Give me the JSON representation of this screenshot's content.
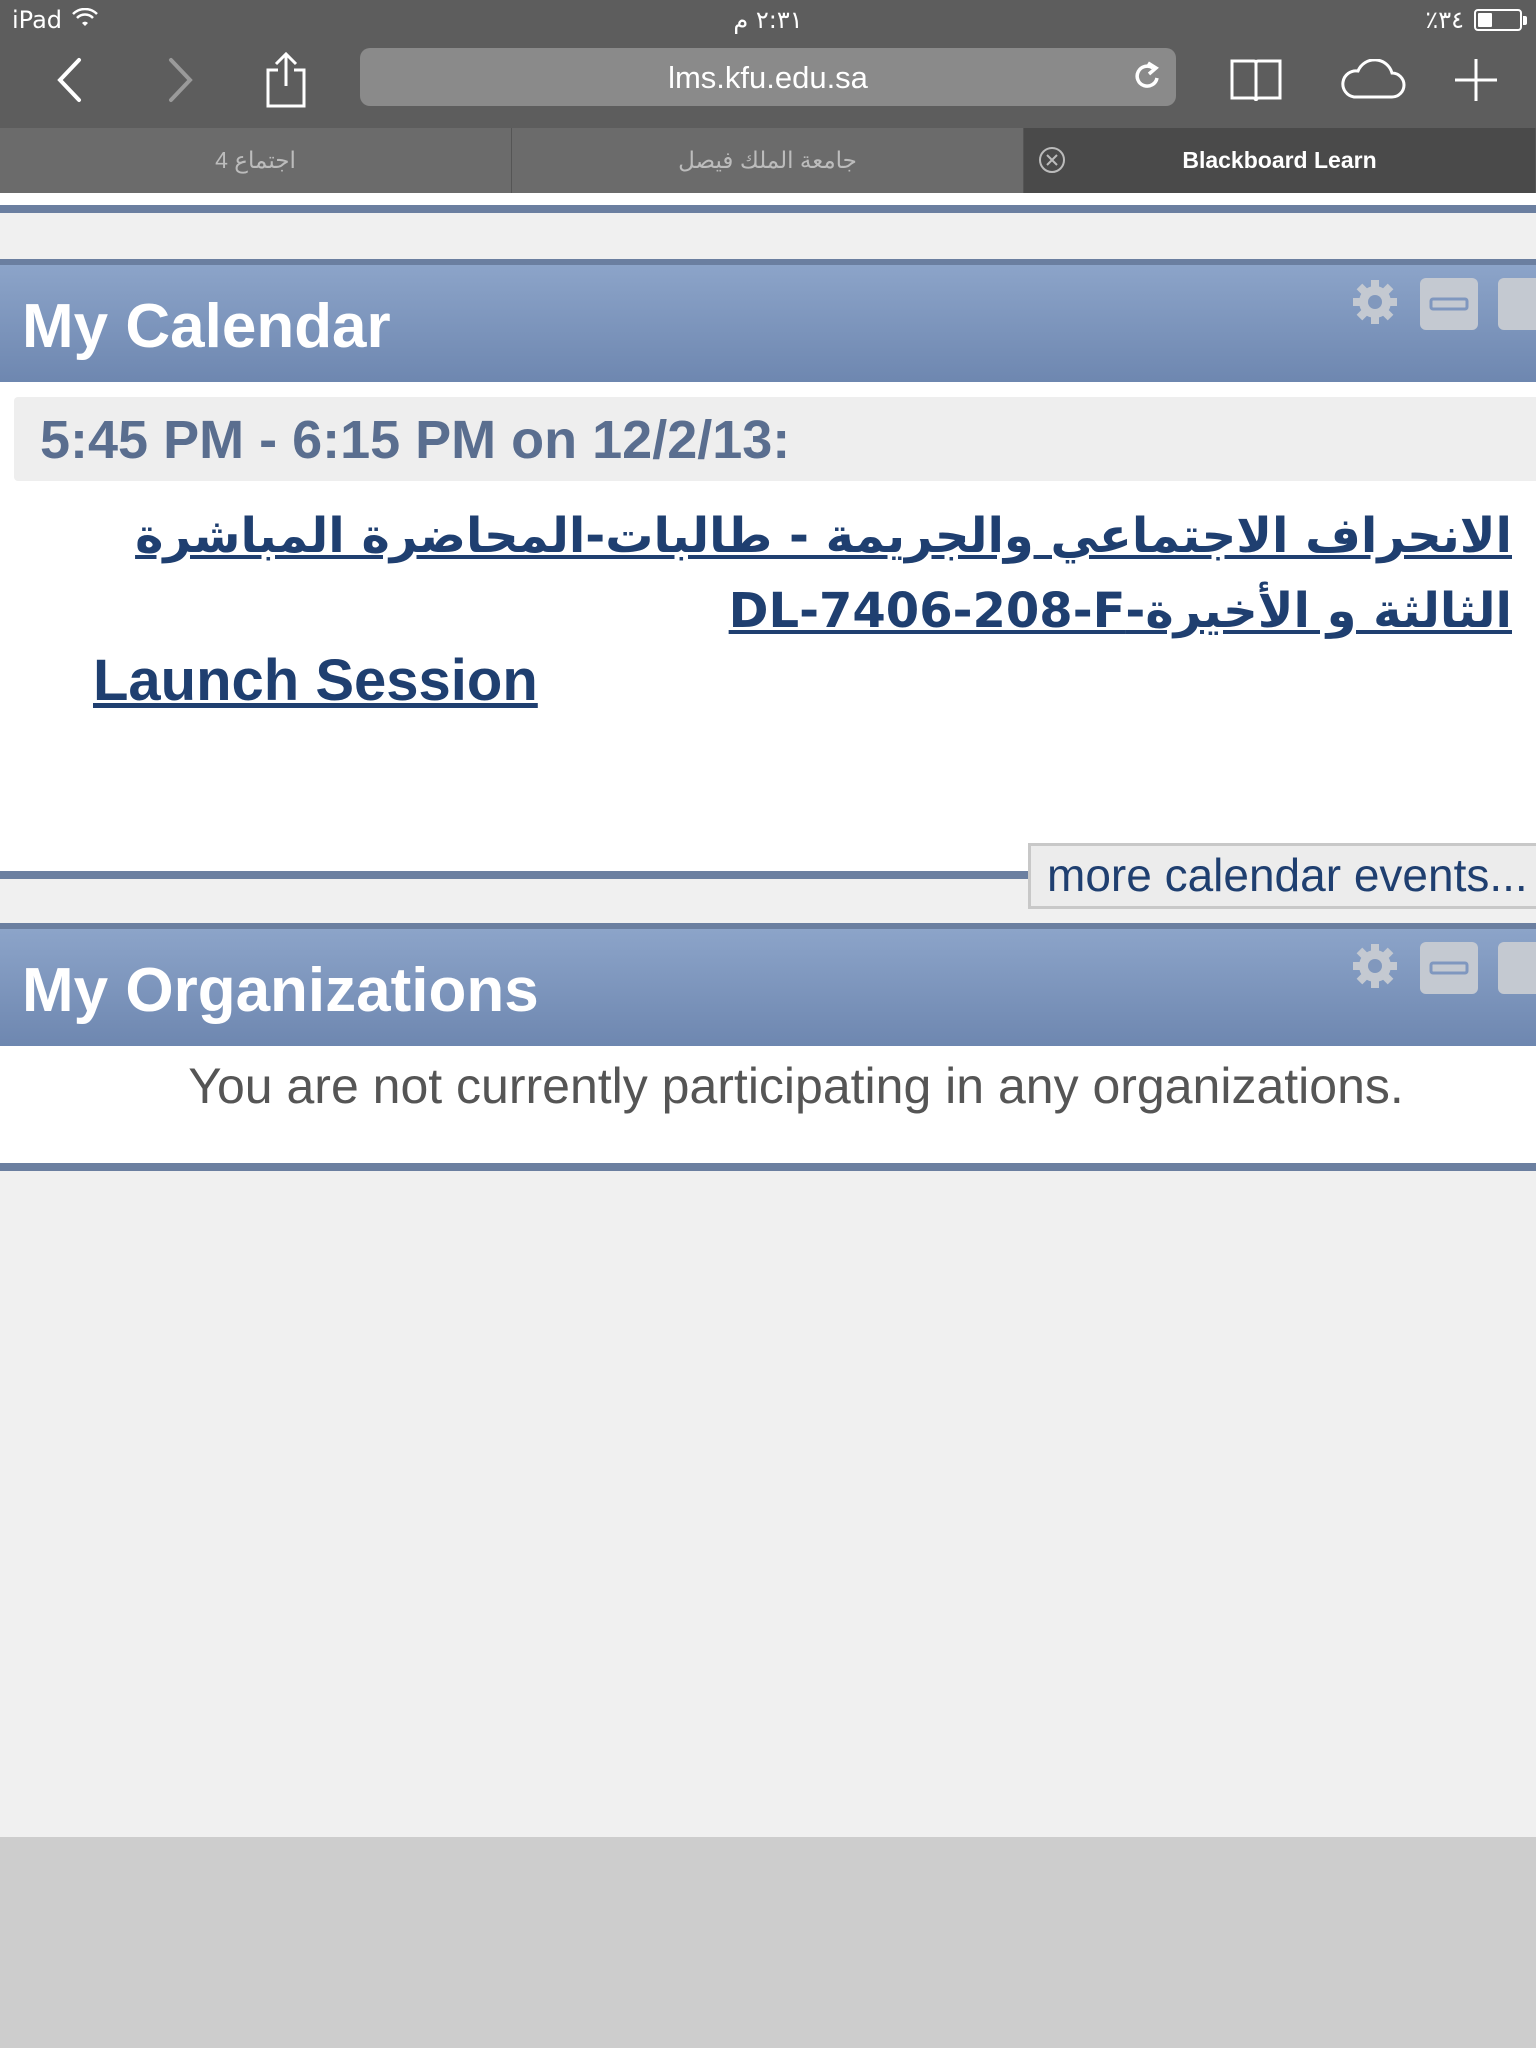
{
  "status": {
    "device": "iPad",
    "time": "٢:٣١ م",
    "battery": "٪٣٤",
    "battery_level": 0.34
  },
  "browser": {
    "url": "lms.kfu.edu.sa",
    "tabs": [
      {
        "label": "اجتماع 4"
      },
      {
        "label": "جامعة الملك فيصل"
      },
      {
        "label": "Blackboard Learn",
        "active": true
      }
    ]
  },
  "calendar": {
    "title": "My Calendar",
    "date_line": "5:45 PM - 6:15 PM on 12/2/13:",
    "event_link": "الانحراف الاجتماعي والجريمة - طالبات-المحاضرة المباشرة الثالثة و الأخيرة-DL-7406-208-F",
    "launch_label": "Launch Session",
    "more_label": "more calendar events..."
  },
  "organizations": {
    "title": "My Organizations",
    "message": "You are not currently participating in any organizations."
  },
  "colors": {
    "header_blue": "#7f97bf",
    "link_navy": "#1f3f70",
    "rule": "#6b7fa0"
  }
}
